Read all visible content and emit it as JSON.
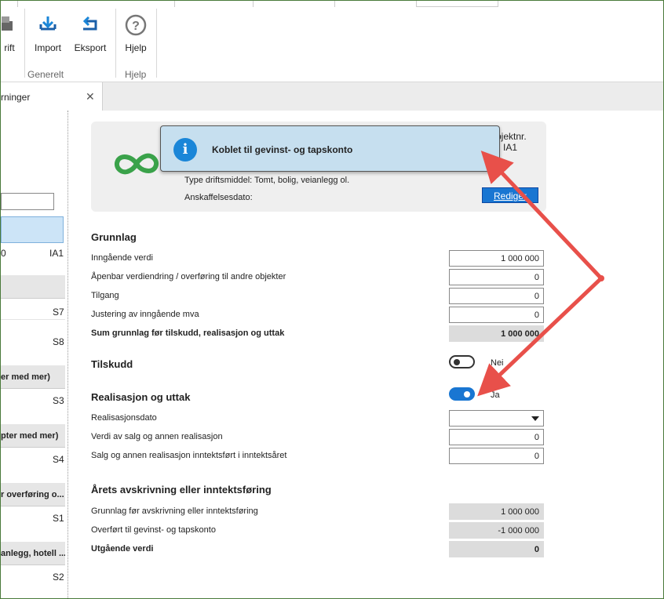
{
  "ribbon": {
    "buttons": [
      {
        "label": "rift",
        "icon": "print-icon"
      },
      {
        "label": "Import",
        "icon": "import-icon"
      },
      {
        "label": "Eksport",
        "icon": "export-icon"
      },
      {
        "label": "Hjelp",
        "icon": "help-icon"
      }
    ],
    "groups": [
      "Generelt",
      "Hjelp"
    ]
  },
  "tab": {
    "label": "rninger",
    "close": "✕"
  },
  "left": {
    "selected_left": "0",
    "selected_right": "IA1",
    "items": [
      {
        "code": "S7"
      },
      {
        "code": "S8"
      },
      {
        "group": "er med mer)"
      },
      {
        "code": "S3"
      },
      {
        "group": "pter med mer)"
      },
      {
        "code": "S4"
      },
      {
        "group": "r overføring o..."
      },
      {
        "code": "S1"
      },
      {
        "group": "anlegg, hotell ..."
      },
      {
        "code": "S2"
      }
    ]
  },
  "card": {
    "objnr_label": "bjektnr.",
    "objnr_value": "IA1",
    "type_line": "Type driftsmiddel: Tomt, bolig, veianlegg ol.",
    "date_line": "Anskaffelsesdato:",
    "edit_label": "Rediger"
  },
  "toast": {
    "icon": "info-icon",
    "message": "Koblet til gevinst- og tapskonto"
  },
  "grunnlag": {
    "title": "Grunnlag",
    "rows": [
      {
        "label": "Inngående verdi",
        "value": "1 000 000"
      },
      {
        "label": "Åpenbar verdiendring / overføring til andre objekter",
        "value": "0"
      },
      {
        "label": "Tilgang",
        "value": "0"
      },
      {
        "label": "Justering av inngående mva",
        "value": "0"
      },
      {
        "label": "Sum grunnlag før tilskudd, realisasjon og uttak",
        "value": "1 000 000"
      }
    ]
  },
  "tilskudd": {
    "title": "Tilskudd",
    "toggle_label": "Nei",
    "on": false
  },
  "realisasjon": {
    "title": "Realisasjon og uttak",
    "toggle_label": "Ja",
    "on": true,
    "rows": [
      {
        "label": "Realisasjonsdato",
        "value": ""
      },
      {
        "label": "Verdi av salg og annen realisasjon",
        "value": "0"
      },
      {
        "label": "Salg og annen realisasjon inntektsført i inntektsåret",
        "value": "0"
      }
    ]
  },
  "avskrivning": {
    "title": "Årets avskrivning eller inntektsføring",
    "rows": [
      {
        "label": "Grunnlag før avskrivning eller inntektsføring",
        "value": "1 000 000"
      },
      {
        "label": "Overført til gevinst- og tapskonto",
        "value": "-1 000 000"
      },
      {
        "label": "Utgående verdi",
        "value": "0"
      }
    ]
  },
  "colors": {
    "accent": "#1976d2",
    "arrow": "#e8504a",
    "logo": "#3aa24a",
    "toast_bg": "#c6dfef"
  }
}
